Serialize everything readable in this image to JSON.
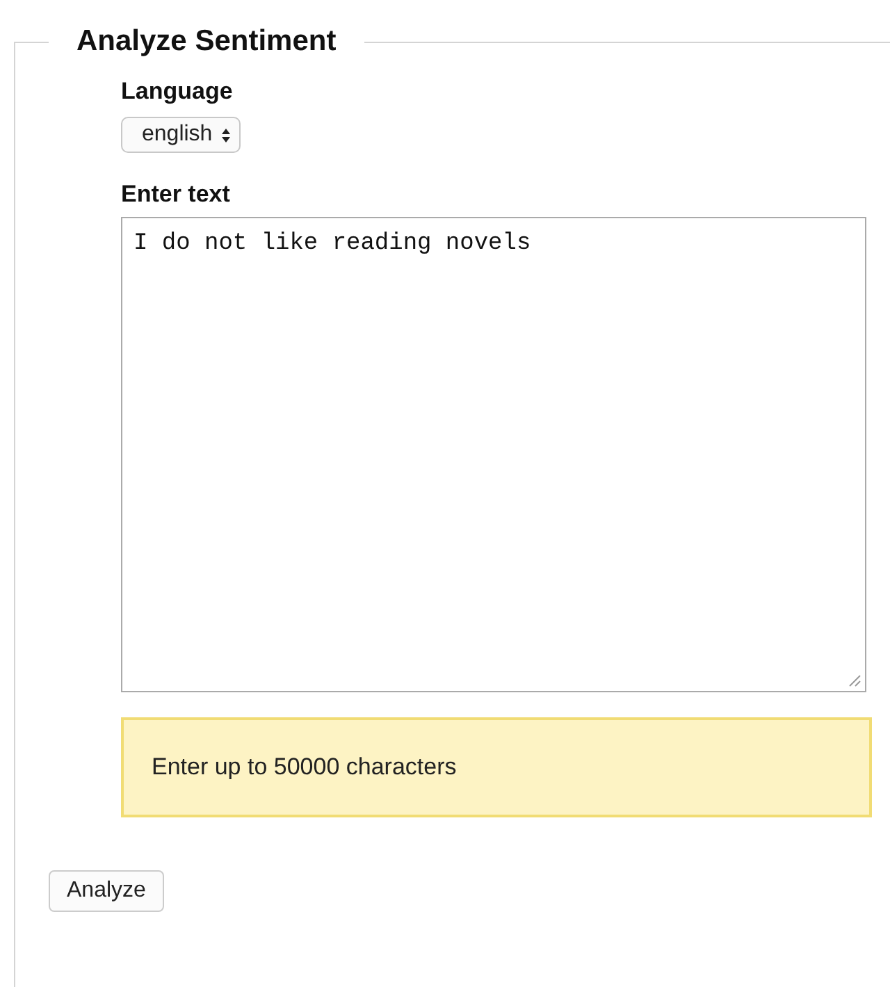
{
  "section": {
    "title": "Analyze Sentiment"
  },
  "language": {
    "label": "Language",
    "value": "english"
  },
  "text_input": {
    "label": "Enter text",
    "value": "I do not like reading novels"
  },
  "notice": "Enter up to 50000 characters",
  "buttons": [
    {
      "label": "Analyze"
    }
  ]
}
